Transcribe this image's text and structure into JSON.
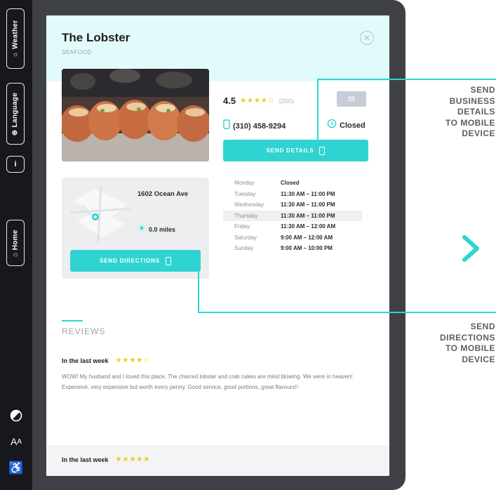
{
  "sidebar": {
    "weather_label": "Weather",
    "language_label": "Language",
    "info_label": "i",
    "home_label": "Home",
    "accessibility_glyph": "♿"
  },
  "business": {
    "name": "The Lobster",
    "category": "SEAFOOD",
    "rating": "4.5",
    "stars": "★★★★☆",
    "review_count": "(200)",
    "price": "$$",
    "phone": "(310) 458-9294",
    "status": "Closed",
    "send_details_label": "SEND DETAILS",
    "address": "1602 Ocean Ave",
    "distance": "0.0 miles",
    "send_directions_label": "SEND DIRECTIONS"
  },
  "hours": [
    {
      "day": "Monday",
      "time": "Closed"
    },
    {
      "day": "Tuesday",
      "time": "11:30 AM – 11:00 PM"
    },
    {
      "day": "Wednesday",
      "time": "11:30 AM – 11:00 PM"
    },
    {
      "day": "Thursday",
      "time": "11:30 AM – 11:00 PM"
    },
    {
      "day": "Friday",
      "time": "11:30 AM – 12:00 AM"
    },
    {
      "day": "Saturday",
      "time": "9:00 AM – 12:00 AM"
    },
    {
      "day": "Sunday",
      "time": "9:00 AM – 10:00 PM"
    }
  ],
  "today_index": 3,
  "reviews": {
    "title": "REVIEWS",
    "items": [
      {
        "period": "In the last week",
        "stars": "★★★★☆",
        "text": "WOW! My husband and I loved this place. The charred lobster and crab cakes are mind blowing. We were in heaven! Expensive, very expensive but worth every penny. Good service, good portions, great flavours!!"
      },
      {
        "period": "In the last week",
        "stars": "★★★★★",
        "text": ""
      }
    ]
  },
  "callouts": {
    "details": "SEND\nBUSINESS\nDETAILS\nTO MOBILE\nDEVICE",
    "directions": "SEND\nDIRECTIONS\nTO MOBILE\nDEVICE"
  },
  "colors": {
    "accent": "#2fd4d2",
    "header_tint": "#e3fafb",
    "star": "#f5c518",
    "rail": "#17181b",
    "frame": "#3f4147"
  },
  "icons": [
    "close-icon",
    "phone-icon",
    "clock-icon",
    "map-pin-icon",
    "location-icon",
    "chevron-right-icon",
    "contrast-icon",
    "text-size-icon",
    "accessibility-icon"
  ]
}
